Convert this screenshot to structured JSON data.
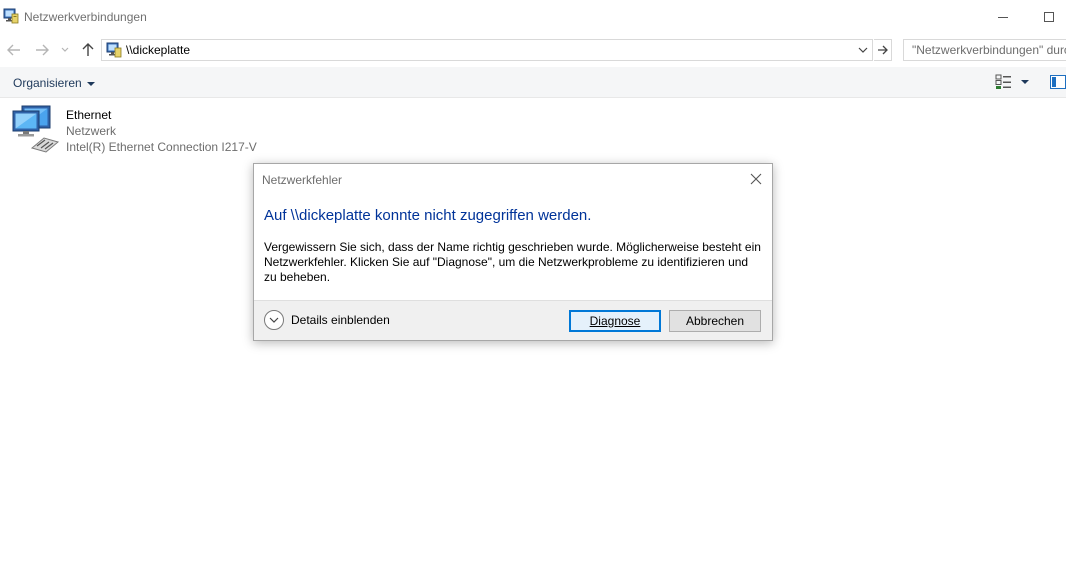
{
  "window": {
    "title": "Netzwerkverbindungen"
  },
  "address": {
    "path": "\\\\dickeplatte"
  },
  "search": {
    "placeholder": "\"Netzwerkverbindungen\" durchsuchen"
  },
  "toolbar": {
    "organize_label": "Organisieren"
  },
  "items": [
    {
      "name": "Ethernet",
      "type": "Netzwerk",
      "device": "Intel(R) Ethernet Connection I217-V"
    }
  ],
  "dialog": {
    "title": "Netzwerkfehler",
    "heading": "Auf \\\\dickeplatte konnte nicht zugegriffen werden.",
    "body": "Vergewissern Sie sich, dass der Name richtig geschrieben wurde. Möglicherweise besteht ein Netzwerkfehler. Klicken Sie auf \"Diagnose\", um die Netzwerkprobleme zu identifizieren und zu beheben.",
    "details_label": "Details einblenden",
    "diagnose_label": "Diagnose",
    "cancel_label": "Abbrechen"
  },
  "colors": {
    "heading": "#003399",
    "accent": "#0078d7",
    "command_text": "#1e395b"
  }
}
